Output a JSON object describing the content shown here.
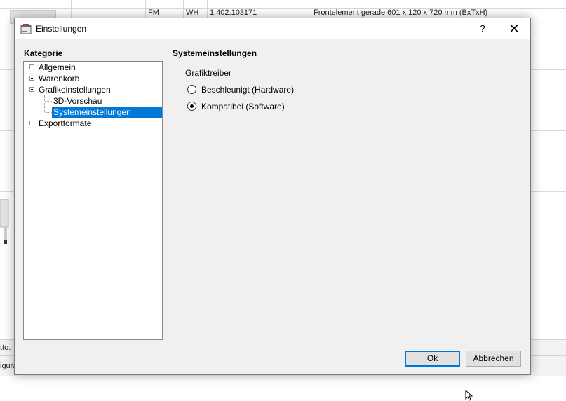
{
  "background": {
    "row_cells": [
      "FM",
      "WH",
      "1.402.103171",
      "Frontelement gerade 601 x 120 x 720 mm (BxTxH)"
    ],
    "strip_labels": [
      "tto:",
      "igura"
    ]
  },
  "dialog": {
    "title": "Einstellungen",
    "help_label": "?",
    "close_label": "✕",
    "category_label": "Kategorie",
    "tree": {
      "items": [
        {
          "label": "Allgemein"
        },
        {
          "label": "Warenkorb"
        },
        {
          "label": "Grafikeinstellungen"
        },
        {
          "label": "3D-Vorschau"
        },
        {
          "label": "Systemeinstellungen"
        },
        {
          "label": "Exportformate"
        }
      ]
    },
    "section_title": "Systemeinstellungen",
    "group": {
      "label": "Grafiktreiber",
      "options": [
        {
          "label": "Beschleunigt  (Hardware)",
          "checked": false
        },
        {
          "label": "Kompatibel (Software)",
          "checked": true
        }
      ]
    },
    "buttons": {
      "ok": "Ok",
      "cancel": "Abbrechen"
    },
    "colors": {
      "selection": "#0078d7",
      "dialog_bg": "#f0f0f0"
    }
  }
}
